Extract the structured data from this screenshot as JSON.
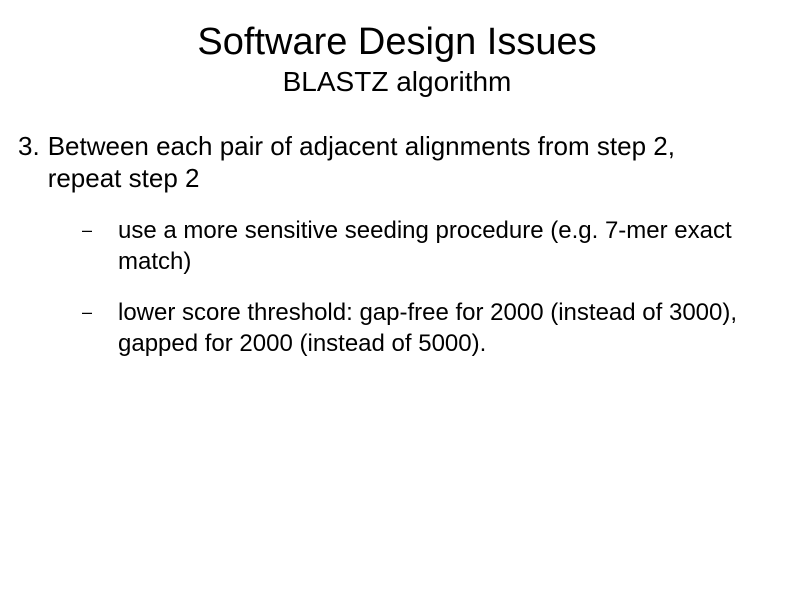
{
  "slide": {
    "title": "Software Design Issues",
    "subtitle": "BLASTZ algorithm",
    "point_number": "3.",
    "point_text": "Between each pair of adjacent alignments from step 2, repeat step 2",
    "sub_items": [
      "use a more sensitive seeding procedure (e.g. 7-mer exact match)",
      "lower score threshold: gap-free for 2000 (instead of 3000), gapped for 2000 (instead of 5000)."
    ],
    "bullet_char": "–"
  }
}
